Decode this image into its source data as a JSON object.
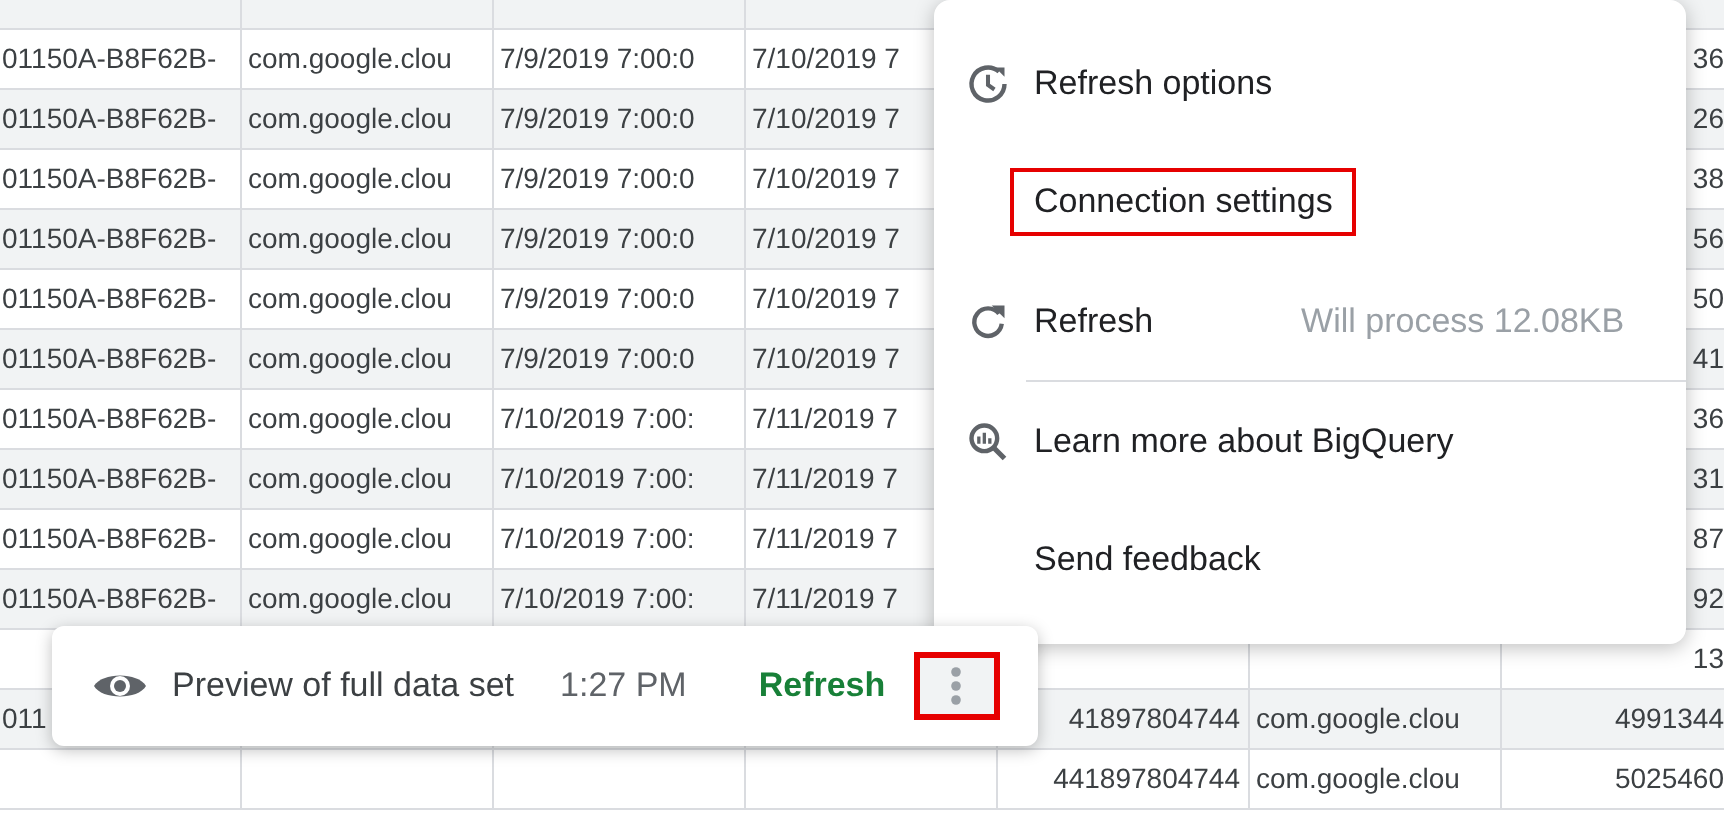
{
  "table": {
    "rows": [
      [
        null,
        null,
        null,
        null,
        null,
        null,
        null
      ],
      [
        "01150A-B8F62B-",
        "com.google.clou",
        "7/9/2019 7:00:0",
        "7/10/2019 7",
        null,
        null,
        "36"
      ],
      [
        "01150A-B8F62B-",
        "com.google.clou",
        "7/9/2019 7:00:0",
        "7/10/2019 7",
        null,
        null,
        "26"
      ],
      [
        "01150A-B8F62B-",
        "com.google.clou",
        "7/9/2019 7:00:0",
        "7/10/2019 7",
        null,
        null,
        "38"
      ],
      [
        "01150A-B8F62B-",
        "com.google.clou",
        "7/9/2019 7:00:0",
        "7/10/2019 7",
        null,
        null,
        "56"
      ],
      [
        "01150A-B8F62B-",
        "com.google.clou",
        "7/9/2019 7:00:0",
        "7/10/2019 7",
        null,
        null,
        "50"
      ],
      [
        "01150A-B8F62B-",
        "com.google.clou",
        "7/9/2019 7:00:0",
        "7/10/2019 7",
        null,
        null,
        "41"
      ],
      [
        "01150A-B8F62B-",
        "com.google.clou",
        "7/10/2019 7:00:",
        "7/11/2019 7",
        null,
        null,
        "36"
      ],
      [
        "01150A-B8F62B-",
        "com.google.clou",
        "7/10/2019 7:00:",
        "7/11/2019 7",
        null,
        null,
        "31"
      ],
      [
        "01150A-B8F62B-",
        "com.google.clou",
        "7/10/2019 7:00:",
        "7/11/2019 7",
        null,
        null,
        "87"
      ],
      [
        "01150A-B8F62B-",
        "com.google.clou",
        "7/10/2019 7:00:",
        "7/11/2019 7",
        null,
        null,
        "92"
      ],
      [
        null,
        null,
        null,
        null,
        null,
        null,
        "13"
      ],
      [
        "011",
        null,
        null,
        null,
        "41897804744",
        "com.google.clou",
        "4991344"
      ],
      [
        null,
        null,
        null,
        null,
        "441897804744",
        "com.google.clou",
        "5025460"
      ]
    ]
  },
  "menu": {
    "items": [
      {
        "kind": "item",
        "label": "Refresh options",
        "highlighted": false
      },
      {
        "kind": "item",
        "label": "Connection settings",
        "highlighted": true
      },
      {
        "kind": "item",
        "label": "Refresh",
        "detail": "Will process 12.08KB",
        "highlighted": false
      },
      {
        "kind": "divider"
      },
      {
        "kind": "item",
        "label": "Learn more about BigQuery",
        "highlighted": false
      },
      {
        "kind": "item",
        "label": "Send feedback",
        "highlighted": false
      }
    ]
  },
  "toolbar": {
    "label": "Preview of full data set",
    "time": "1:27 PM",
    "action": "Refresh",
    "more_highlighted": true
  }
}
